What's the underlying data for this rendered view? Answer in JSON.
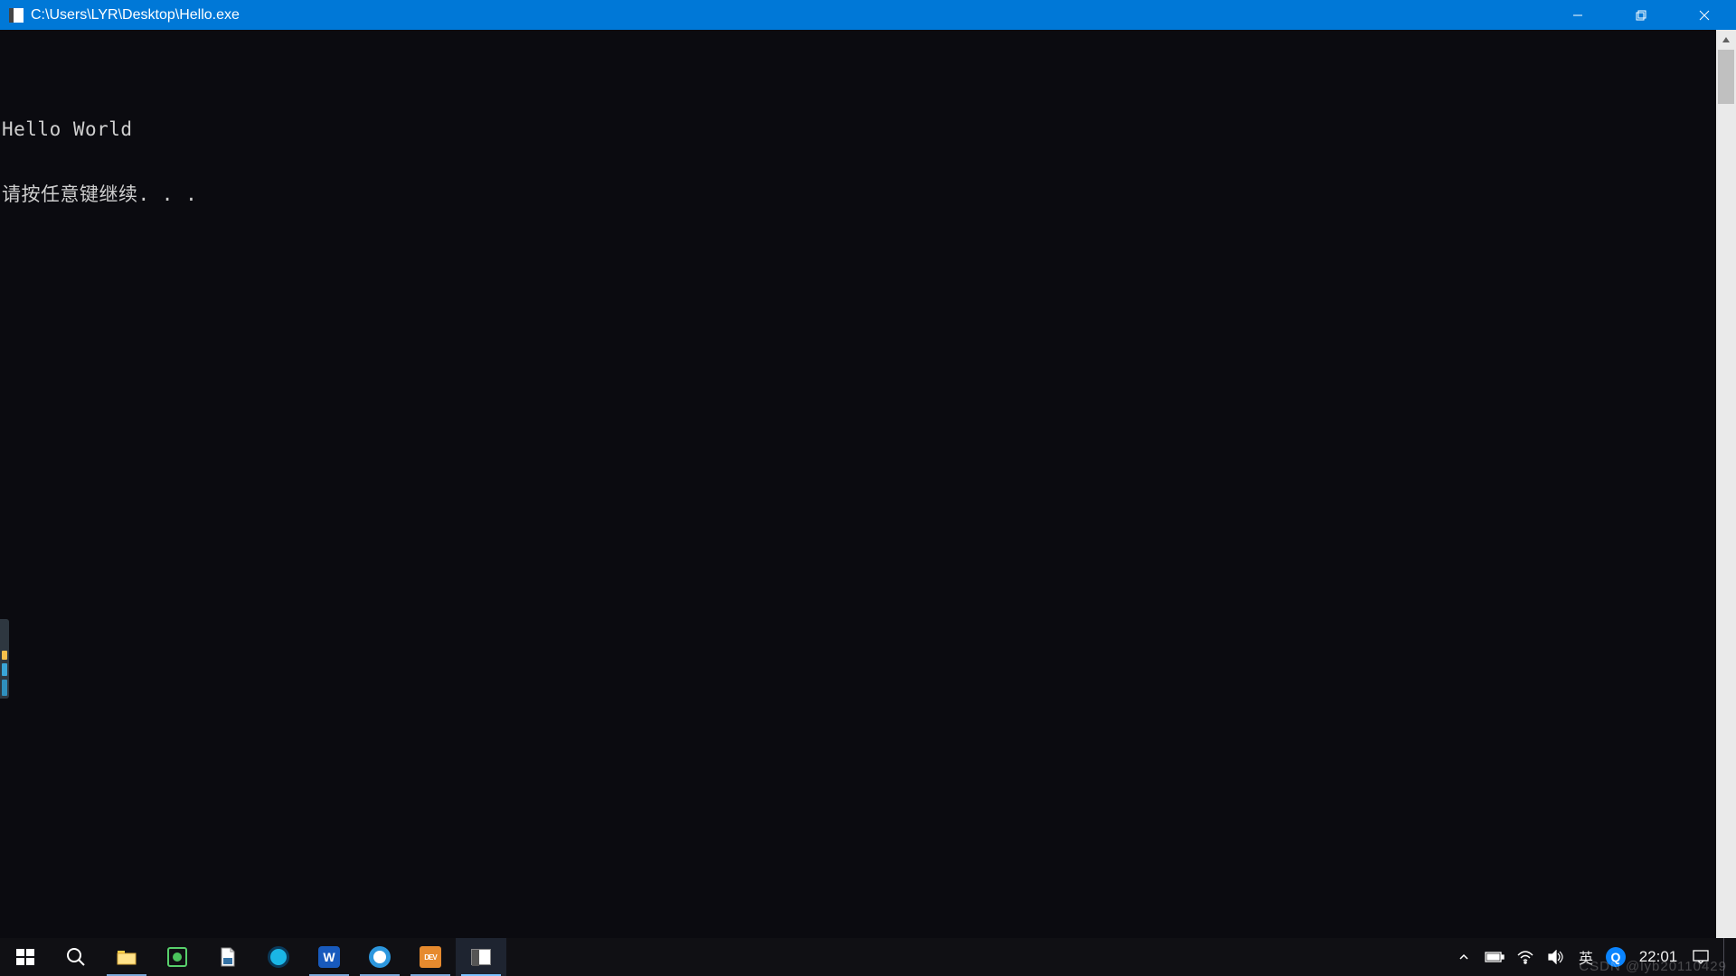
{
  "window": {
    "title": "C:\\Users\\LYR\\Desktop\\Hello.exe"
  },
  "console": {
    "lines": [
      "Hello World",
      "请按任意键继续. . ."
    ]
  },
  "taskbar": {
    "items": [
      {
        "name": "start",
        "label": "Start",
        "open": false,
        "active": false
      },
      {
        "name": "search",
        "label": "Search",
        "open": false,
        "active": false
      },
      {
        "name": "file-explorer",
        "label": "File Explorer",
        "open": true,
        "active": false
      },
      {
        "name": "pycharm",
        "label": "PyCharm",
        "open": false,
        "active": false
      },
      {
        "name": "python-file",
        "label": "Python File",
        "open": false,
        "active": false
      },
      {
        "name": "browser-q",
        "label": "Browser",
        "open": false,
        "active": false
      },
      {
        "name": "word",
        "label": "Microsoft Word",
        "open": true,
        "active": false
      },
      {
        "name": "browser-o",
        "label": "Browser 2",
        "open": true,
        "active": false
      },
      {
        "name": "devcpp",
        "label": "Dev-C++",
        "open": true,
        "active": false
      },
      {
        "name": "console",
        "label": "Console Window",
        "open": true,
        "active": true
      }
    ],
    "tray": {
      "ime": "英",
      "clock": "22:01",
      "quick_badge": "Q"
    }
  },
  "watermark": "CSDN @lyb20110429"
}
